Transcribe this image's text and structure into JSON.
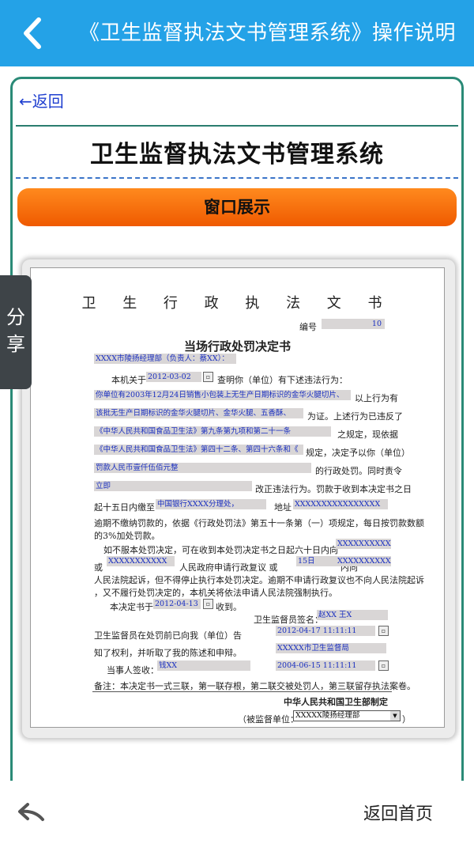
{
  "header": {
    "title": "《卫生监督执法文书管理系统》操作说明"
  },
  "card": {
    "back_link": "←返回",
    "heading": "卫生监督执法文书管理系统",
    "section_button": "窗口展示"
  },
  "document": {
    "title": "卫 生 行 政 执 法 文 书",
    "number_label": "编号",
    "number_value": "10",
    "subtitle": "当场行政处罚决定书",
    "party": "XXXX市陵扬经理部（负责人：蔡XX）：",
    "line1_prefix": "本机关于",
    "date1": "2012-03-02",
    "line1_suffix": "查明你（单位）有下述违法行为：",
    "violation_1": "你单位有2003年12月24日销售小包装上无生产日期标识的金华火腿切片、",
    "line2_suffix": "以上行为有",
    "violation_2": "该批无生产日期标识的金华火腿切片、金华火腿、五香酥、",
    "line3_suffix": "为证。上述行为已违反了",
    "law_1": "《中华人民共和国食品卫生法》第九条第九项和第二十一条",
    "line4_suffix": "之规定，现依据",
    "law_2": "《中华人民共和国食品卫生法》第四十二条、第四十六条和《",
    "line5_suffix": "规定，决定予以你（单位）",
    "penalty": "罚款人民币壹仟伍佰元整",
    "line6_suffix": "的行政处罚。同时责令",
    "correction": "立即",
    "line7_suffix": "改正违法行为。罚款于收到本决定书之日",
    "pay_prefix": "起十五日内缴至",
    "bank": "中国银行XXXX分理处，",
    "addr_label": "地址",
    "addr_value": "XXXXXXXXXXXXXXXX",
    "late_fee_1": "逾期不缴纳罚款的，依据《行政处罚法》第五十一条第（一）项规定，每日按罚款数额",
    "late_fee_2": "的3%加处罚款。",
    "appeal_prefix": "如不服本处罚决定，可在收到本处罚决定书之日起六十日内向",
    "appeal_org": "XXXXXXXXXXXXXX",
    "or_label": "或",
    "gov": "XXXXXXXXXXX",
    "gov_suffix": "人民政府申请行政复议 或",
    "days": "15日",
    "within": "内向",
    "court": "XXXXXXXXXXXXXX",
    "court_line": "人民法院起诉，但不得停止执行本处罚决定。逾期不申请行政复议也不向人民法院起诉",
    "enforce_line": "，又不履行处罚决定的，本机关将依法申请人民法院强制执行。",
    "decision_prefix": "本决定书于",
    "decision_date": "2012-04-13",
    "decision_suffix": "收到。",
    "inspector_label": "卫生监督员签名：",
    "inspector_value": "赵XX  王X",
    "notice_1": "卫生监督员在处罚前已向我（单位）告",
    "inspect_date": "2012-04-17 11:11:11",
    "notice_2": "知了权利，并听取了我的陈述和申辩。",
    "bureau": "XXXXX市卫生监督局",
    "signer_label": "当事人签收：",
    "signer_value": "钱XX",
    "sign_date": "2004-06-15 11:11:11",
    "remark": "备注：本决定书一式三联，第一联存根，第二联交被处罚人，第三联留存执法案卷。",
    "maker": "中华人民共和国卫生部制定",
    "unit_label": "（被监督单位：",
    "unit_value": "XXXXX陵扬经理部",
    "unit_close": "）",
    "cal_glyph": "▫",
    "select_arrow": "▼"
  },
  "share_tab": {
    "label": "分享"
  },
  "bottom": {
    "home_label": "返回首页"
  },
  "colors": {
    "topbar": "#24a2e7",
    "card_border": "#2a8a77",
    "orange": "#f06a00",
    "share_tab": "#3e4448"
  },
  "icons": {
    "back": "chevron-left-icon",
    "bottom_back": "reply-arrow-icon"
  }
}
